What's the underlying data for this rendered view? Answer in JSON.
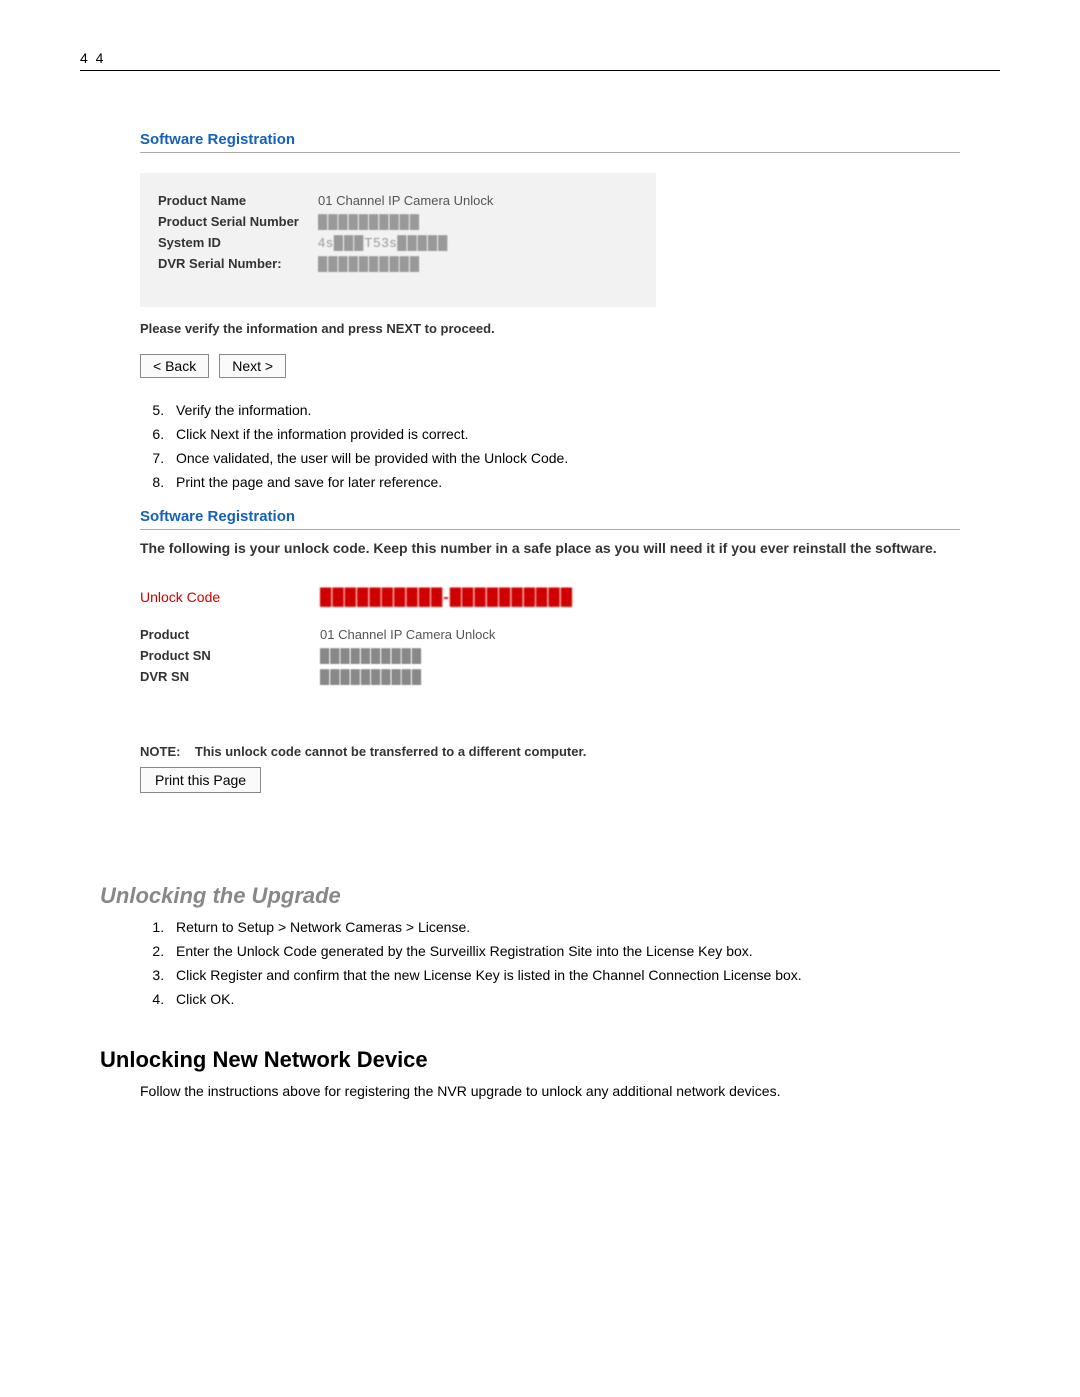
{
  "page_number": "4 4",
  "screenshot1": {
    "header": "Software Registration",
    "rows": [
      {
        "label": "Product Name",
        "value": "01 Channel IP Camera Unlock",
        "blur": false
      },
      {
        "label": "Product Serial Number",
        "value": "██████████",
        "blur": true
      },
      {
        "label": "System ID",
        "value": "4s███T53s█████",
        "blur": true
      },
      {
        "label": "DVR Serial Number:",
        "value": "██████████",
        "blur": true
      }
    ],
    "verify_text": "Please verify the information and press NEXT to proceed.",
    "back_button": "< Back",
    "next_button": "Next >"
  },
  "steps1": [
    "Verify the information.",
    "Click Next if the information provided is correct.",
    "Once validated, the user will be provided with the Unlock Code.",
    "Print the page and save for later reference."
  ],
  "steps1_start": 5,
  "screenshot2": {
    "header": "Software Registration",
    "intro": "The following is your unlock code. Keep this number in a safe place as you will need it if you ever reinstall the software.",
    "unlock_label": "Unlock Code",
    "unlock_value": "██████████-██████████",
    "rows": [
      {
        "label": "Product",
        "value": "01 Channel IP Camera Unlock",
        "blur": false
      },
      {
        "label": "Product SN",
        "value": "██████████",
        "blur": true
      },
      {
        "label": "DVR SN",
        "value": "██████████",
        "blur": true
      }
    ],
    "note_label": "NOTE:",
    "note_text": "This unlock code cannot be transferred to a different computer.",
    "print_button": "Print this Page"
  },
  "section2": {
    "heading": "Unlocking the Upgrade",
    "steps": [
      "Return to Setup > Network Cameras > License.",
      "Enter the Unlock Code generated by the Surveillix Registration Site into the License Key box.",
      "Click Register and confirm that the new License Key is listed in the Channel Connection License box.",
      "Click OK."
    ]
  },
  "section3": {
    "heading": "Unlocking New Network Device",
    "body": "Follow the instructions above for registering the NVR upgrade to unlock any additional network devices."
  }
}
